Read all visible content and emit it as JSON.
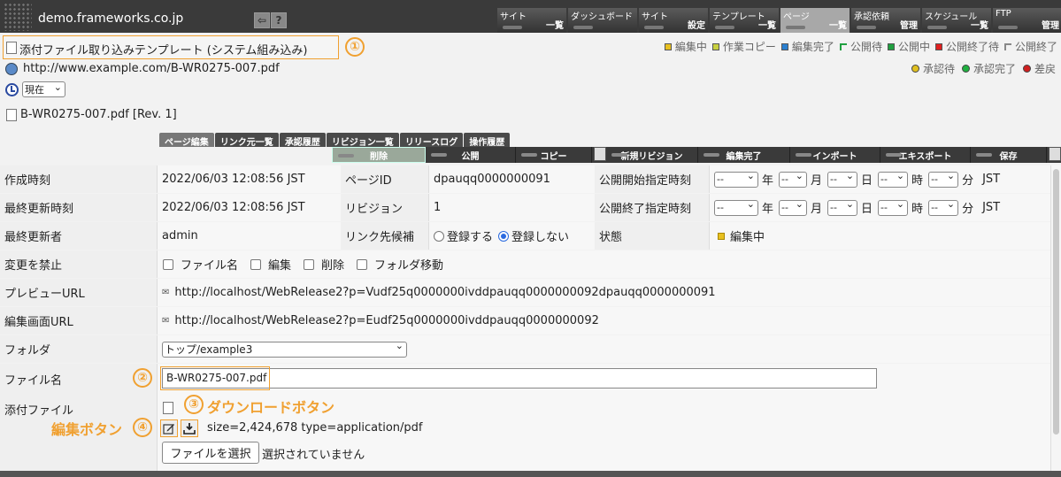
{
  "site": {
    "name": "demo.frameworks.co.jp"
  },
  "toolbar": {
    "back_icon": "⇦",
    "help_icon": "?"
  },
  "nav": [
    {
      "top": "サイト",
      "bottom": "一覧",
      "selected": false
    },
    {
      "top": "ダッシュボード",
      "bottom": "",
      "selected": false
    },
    {
      "top": "サイト",
      "bottom": "設定",
      "selected": false
    },
    {
      "top": "テンプレート",
      "bottom": "一覧",
      "selected": false
    },
    {
      "top": "ページ",
      "bottom": "一覧",
      "selected": true
    },
    {
      "top": "承認依頼",
      "bottom": "管理",
      "selected": false
    },
    {
      "top": "スケジュール",
      "bottom": "一覧",
      "selected": false
    },
    {
      "top": "FTP",
      "bottom": "管理",
      "selected": false
    }
  ],
  "header": {
    "template_title": "添付ファイル取り込みテンプレート (システム組み込み)",
    "url": "http://www.example.com/B-WR0275-007.pdf",
    "time_select": "現在",
    "revision_line": "B-WR0275-007.pdf [Rev. 1]"
  },
  "annotations": {
    "one": "①",
    "two": "②",
    "three": "③",
    "four": "④",
    "download_label": "ダウンロードボタン",
    "edit_label": "編集ボタン"
  },
  "legend": {
    "row1": [
      {
        "label": "編集中",
        "color": "#e8c020",
        "shape": "square"
      },
      {
        "label": "作業コピー",
        "color": "#c8d040",
        "shape": "square"
      },
      {
        "label": "編集完了",
        "color": "#2a80d0",
        "shape": "square"
      },
      {
        "label": "公開待",
        "color": "#20a040",
        "shape": "open"
      },
      {
        "label": "公開中",
        "color": "#20a040",
        "shape": "square"
      },
      {
        "label": "公開終了待",
        "color": "#e02020",
        "shape": "square"
      },
      {
        "label": "公開終了",
        "color": "#888888",
        "shape": "open"
      }
    ],
    "row2": [
      {
        "label": "承認待",
        "color": "#e0c020"
      },
      {
        "label": "承認完了",
        "color": "#20b040"
      },
      {
        "label": "差戻",
        "color": "#d02020"
      }
    ]
  },
  "tabs": [
    "ページ編集",
    "リンク元一覧",
    "承認履歴",
    "リビジョン一覧",
    "リリースログ",
    "操作履歴"
  ],
  "actions": [
    {
      "label": "削除",
      "width": 106,
      "highlighted": true
    },
    {
      "label": "公開",
      "width": 102,
      "highlighted": false
    },
    {
      "label": "コピー",
      "width": 86,
      "highlighted": false,
      "icon": true
    },
    {
      "label": "新規リビジョン",
      "width": 104,
      "highlighted": false
    },
    {
      "label": "編集完了",
      "width": 104,
      "highlighted": false
    },
    {
      "label": "インポート",
      "width": 102,
      "highlighted": false
    },
    {
      "label": "エキスポート",
      "width": 102,
      "highlighted": false
    },
    {
      "label": "保存",
      "width": 86,
      "highlighted": false,
      "icon": true
    }
  ],
  "form": {
    "created_label": "作成時刻",
    "created_value": "2022/06/03 12:08:56 JST",
    "page_id_label": "ページID",
    "page_id_value": "dpauqq0000000091",
    "pub_start_label": "公開開始指定時刻",
    "updated_label": "最終更新時刻",
    "updated_value": "2022/06/03 12:08:56 JST",
    "revision_label": "リビジョン",
    "revision_value": "1",
    "pub_end_label": "公開終了指定時刻",
    "updater_label": "最終更新者",
    "updater_value": "admin",
    "link_label": "リンク先候補",
    "link_register": "登録する",
    "link_no_register": "登録しない",
    "state_label": "状態",
    "state_value": "編集中",
    "date_placeholder": "--",
    "units": {
      "year": "年",
      "month": "月",
      "day": "日",
      "hour": "時",
      "minute": "分",
      "tz": "JST"
    },
    "lock_label": "変更を禁止",
    "lock_options": [
      "ファイル名",
      "編集",
      "削除",
      "フォルダ移動"
    ],
    "preview_label": "プレビューURL",
    "preview_value": "http://localhost/WebRelease2?p=Vudf25q0000000ivddpauqq0000000092dpauqq0000000091",
    "edit_url_label": "編集画面URL",
    "edit_url_value": "http://localhost/WebRelease2?p=Eudf25q0000000ivddpauqq0000000092",
    "folder_label": "フォルダ",
    "folder_value": "トップ/example3",
    "filename_label": "ファイル名",
    "filename_value": "B-WR0275-007.pdf",
    "attach_label": "添付ファイル",
    "attach_info": "size=2,424,678 type=application/pdf",
    "choose_file": "ファイルを選択",
    "no_file": "選択されていません"
  }
}
